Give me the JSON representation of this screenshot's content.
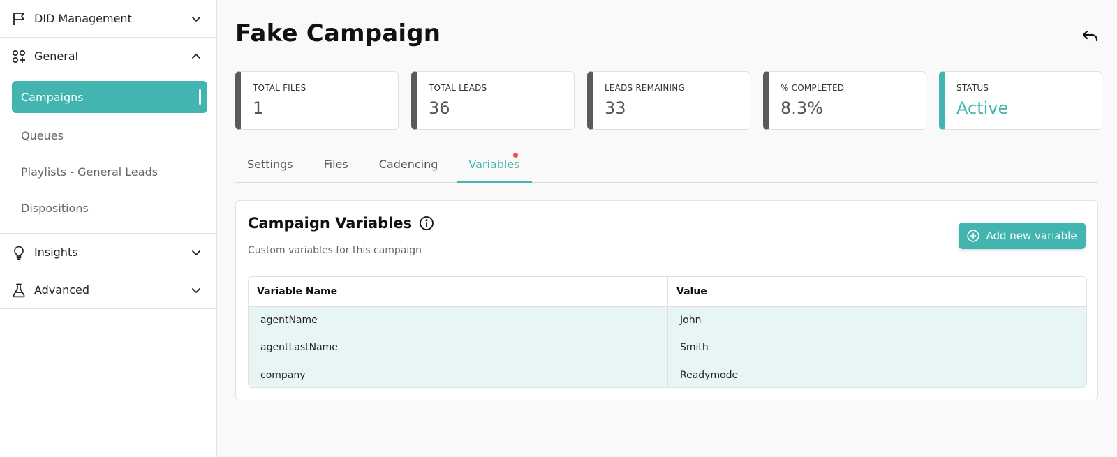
{
  "sidebar": {
    "did_management": "DID Management",
    "general": "General",
    "general_items": [
      {
        "label": "Campaigns",
        "active": true
      },
      {
        "label": "Queues"
      },
      {
        "label": "Playlists - General Leads"
      },
      {
        "label": "Dispositions"
      }
    ],
    "insights": "Insights",
    "advanced": "Advanced"
  },
  "page": {
    "title": "Fake Campaign"
  },
  "stats": [
    {
      "label": "TOTAL FILES",
      "value": "1"
    },
    {
      "label": "TOTAL LEADS",
      "value": "36"
    },
    {
      "label": "LEADS REMAINING",
      "value": "33"
    },
    {
      "label": "% COMPLETED",
      "value": "8.3%"
    },
    {
      "label": "STATUS",
      "value": "Active"
    }
  ],
  "tabs": [
    "Settings",
    "Files",
    "Cadencing",
    "Variables"
  ],
  "active_tab": "Variables",
  "variables": {
    "title": "Campaign Variables",
    "subtitle": "Custom variables for this campaign",
    "add_button": "Add new variable",
    "columns": [
      "Variable Name",
      "Value"
    ],
    "rows": [
      [
        "agentName",
        "John"
      ],
      [
        "agentLastName",
        "Smith"
      ],
      [
        "company",
        "Readymode"
      ]
    ]
  },
  "colors": {
    "accent": "#42b5b1",
    "stat_border": "#5a5a5a",
    "notify_dot": "#e45151",
    "row_bg": "#e7f5f4"
  },
  "icons": {
    "did_management": "flag-icon",
    "general": "shapes-icon",
    "insights": "lightbulb-icon",
    "advanced": "flask-icon",
    "undo": "undo-icon",
    "info": "info-icon",
    "add": "plus-circle-icon"
  }
}
